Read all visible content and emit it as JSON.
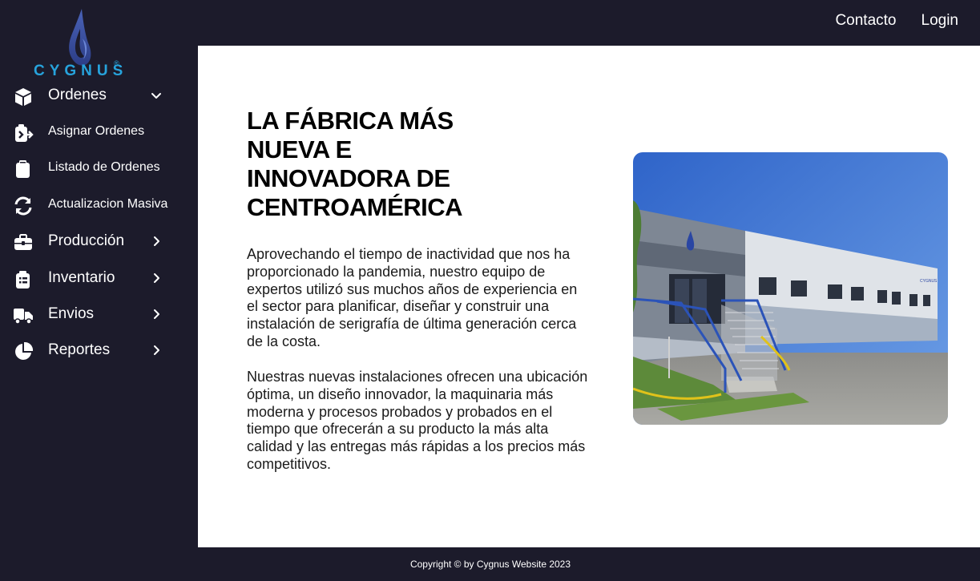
{
  "top_nav": {
    "contact": "Contacto",
    "login": "Login"
  },
  "brand": {
    "name": "CYGNUS",
    "reg": "®",
    "color": "#27a3dc"
  },
  "sidebar": {
    "items": [
      {
        "label": "Ordenes",
        "icon": "box-icon",
        "chevron": "chevron-down"
      },
      {
        "label": "Asignar Ordenes",
        "icon": "clipboard-arrow-icon"
      },
      {
        "label": "Listado de Ordenes",
        "icon": "clipboard-icon"
      },
      {
        "label": "Actualizacion Masiva",
        "icon": "refresh-icon"
      },
      {
        "label": "Producción",
        "icon": "briefcase-icon",
        "chevron": "chevron-right"
      },
      {
        "label": "Inventario",
        "icon": "clipboard-list-icon",
        "chevron": "chevron-right"
      },
      {
        "label": "Envios",
        "icon": "truck-icon",
        "chevron": "chevron-right"
      },
      {
        "label": "Reportes",
        "icon": "pie-chart-icon",
        "chevron": "chevron-right"
      }
    ]
  },
  "main": {
    "headline": "LA FÁBRICA MÁS NUEVA E INNOVADORA DE CENTROAMÉRICA",
    "paragraph1": "Aprovechando el tiempo de inactividad que nos ha proporcionado la pandemia, nuestro equipo de expertos utilizó sus muchos años de experiencia en el sector para planificar, diseñar y construir una instalación de serigrafía de última generación cerca de la costa.",
    "paragraph2": "Nuestras nuevas instalaciones ofrecen una ubicación óptima, un diseño innovador, la maquinaria más moderna y procesos probados y probados en el tiempo que ofrecerán a su producto la más alta calidad y las entregas más rápidas a los precios más competitivos.",
    "photo_sign": "CYGNUS"
  },
  "footer": {
    "text": "Copyright © by Cygnus Website 2023"
  },
  "colors": {
    "dark": "#1c1b2b",
    "accent": "#27a3dc",
    "white": "#ffffff"
  }
}
